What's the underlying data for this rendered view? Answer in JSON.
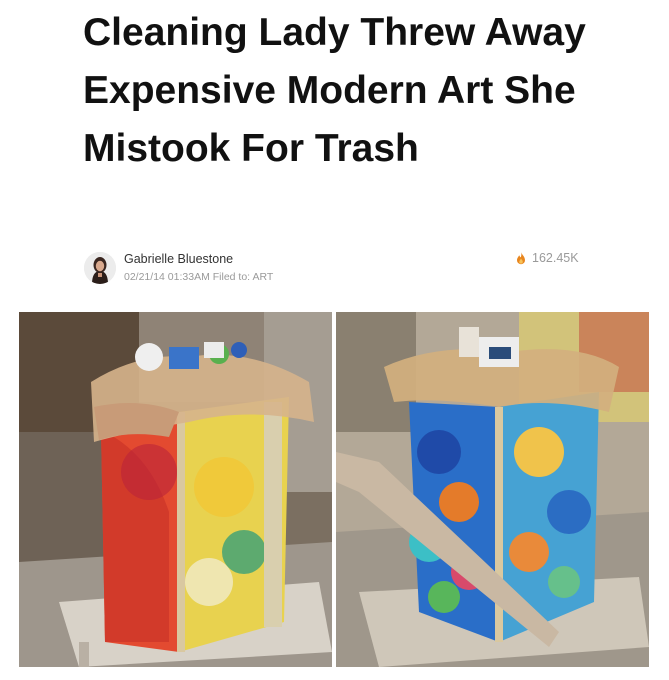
{
  "article": {
    "headline": "Cleaning Lady Threw Away Expensive Modern Art She Mistook For Trash"
  },
  "byline": {
    "author": "Gabrielle Bluestone",
    "timestamp": "02/21/14 01:33AM",
    "filed_label": "Filed to:",
    "category": "ART",
    "views": "162.45K",
    "views_icon": "flame-icon"
  },
  "image": {
    "left_panel": "painted-trash-bin-red-yellow",
    "right_panel": "painted-trash-bin-blue-multicolor"
  },
  "colors": {
    "headline": "#111111",
    "meta_text": "#9a9a9a",
    "flame": "#e8861f"
  }
}
